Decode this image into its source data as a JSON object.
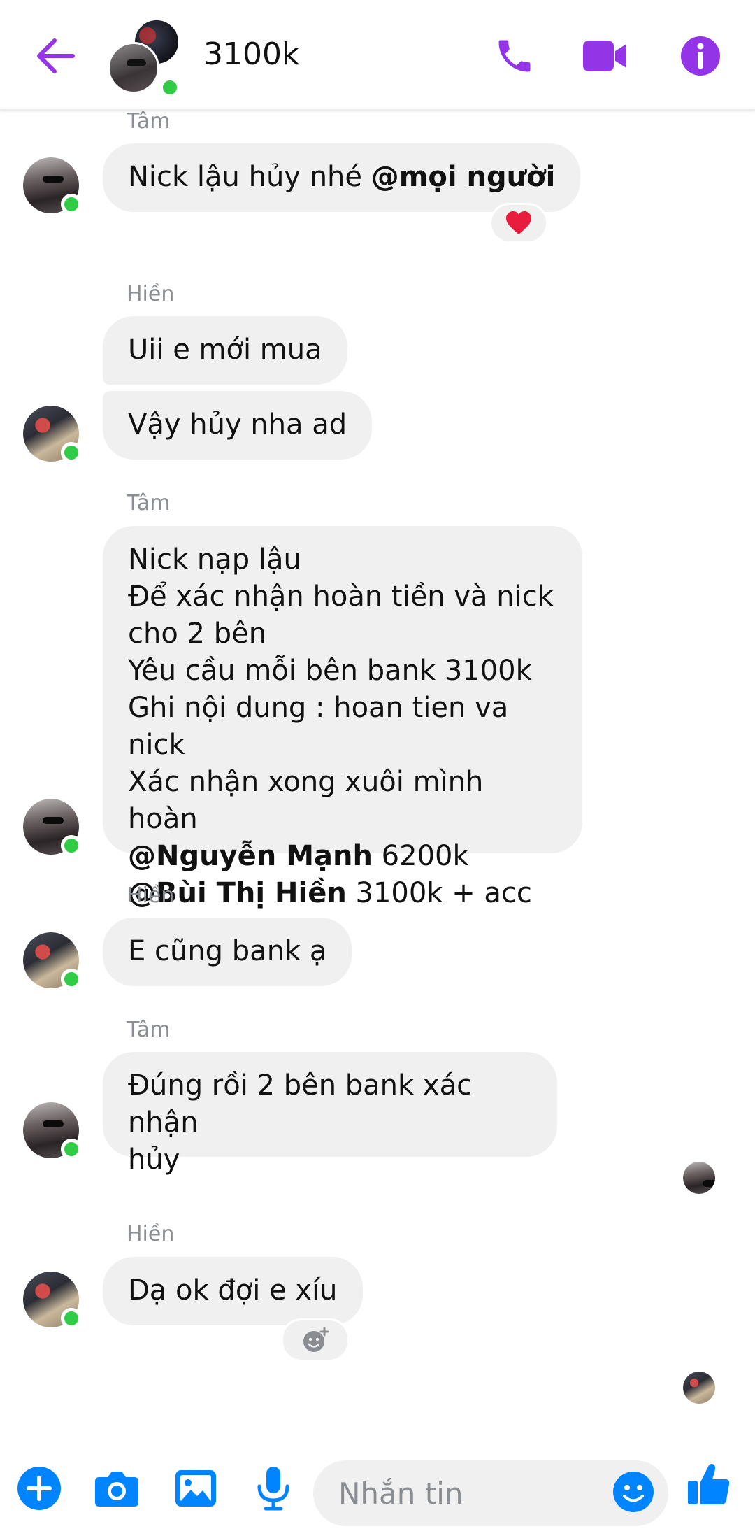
{
  "header": {
    "title": "3100k",
    "icons": [
      "back-arrow-icon",
      "phone-icon",
      "video-camera-icon",
      "info-icon"
    ]
  },
  "colors": {
    "accent": "#9334e6",
    "composer_blue": "#0084ff",
    "online": "#31cc46",
    "bubble": "#f0f0f0",
    "sender": "#8a8d91"
  },
  "messages": [
    {
      "sender": "Tâm",
      "text_parts": [
        "Nick lậu hủy nhé ",
        "@mọi người"
      ]
    },
    {
      "sender": "Hiền",
      "lines": [
        "Uii e mới mua",
        "Vậy hủy nha ad"
      ]
    },
    {
      "sender": "Tâm",
      "lines": [
        "Nick nạp lậu",
        "Để xác nhận hoàn tiền và nick",
        "cho 2 bên",
        "Yêu cầu mỗi bên bank 3100k",
        "Ghi nội dung : hoan tien va nick",
        "Xác nhận xong xuôi mình hoàn"
      ],
      "mentions": [
        {
          "name": "@Nguyễn Mạnh",
          "rest": " 6200k"
        },
        {
          "name": "@Bùi Thị Hiền",
          "rest": " 3100k + acc"
        }
      ]
    },
    {
      "sender": "Hiền",
      "text": "E cũng bank ạ"
    },
    {
      "sender": "Tâm",
      "lines": [
        "Đúng rồi 2 bên bank xác nhận",
        "hủy"
      ]
    },
    {
      "sender": "Hiền",
      "text": "Dạ ok đợi e xíu"
    }
  ],
  "reactions": {
    "heart": "heart-reaction",
    "add": "add-reaction-icon"
  },
  "composer": {
    "placeholder": "Nhắn tin",
    "icons": [
      "plus-icon",
      "camera-icon",
      "gallery-icon",
      "microphone-icon",
      "emoji-icon",
      "thumbs-up-icon"
    ]
  }
}
